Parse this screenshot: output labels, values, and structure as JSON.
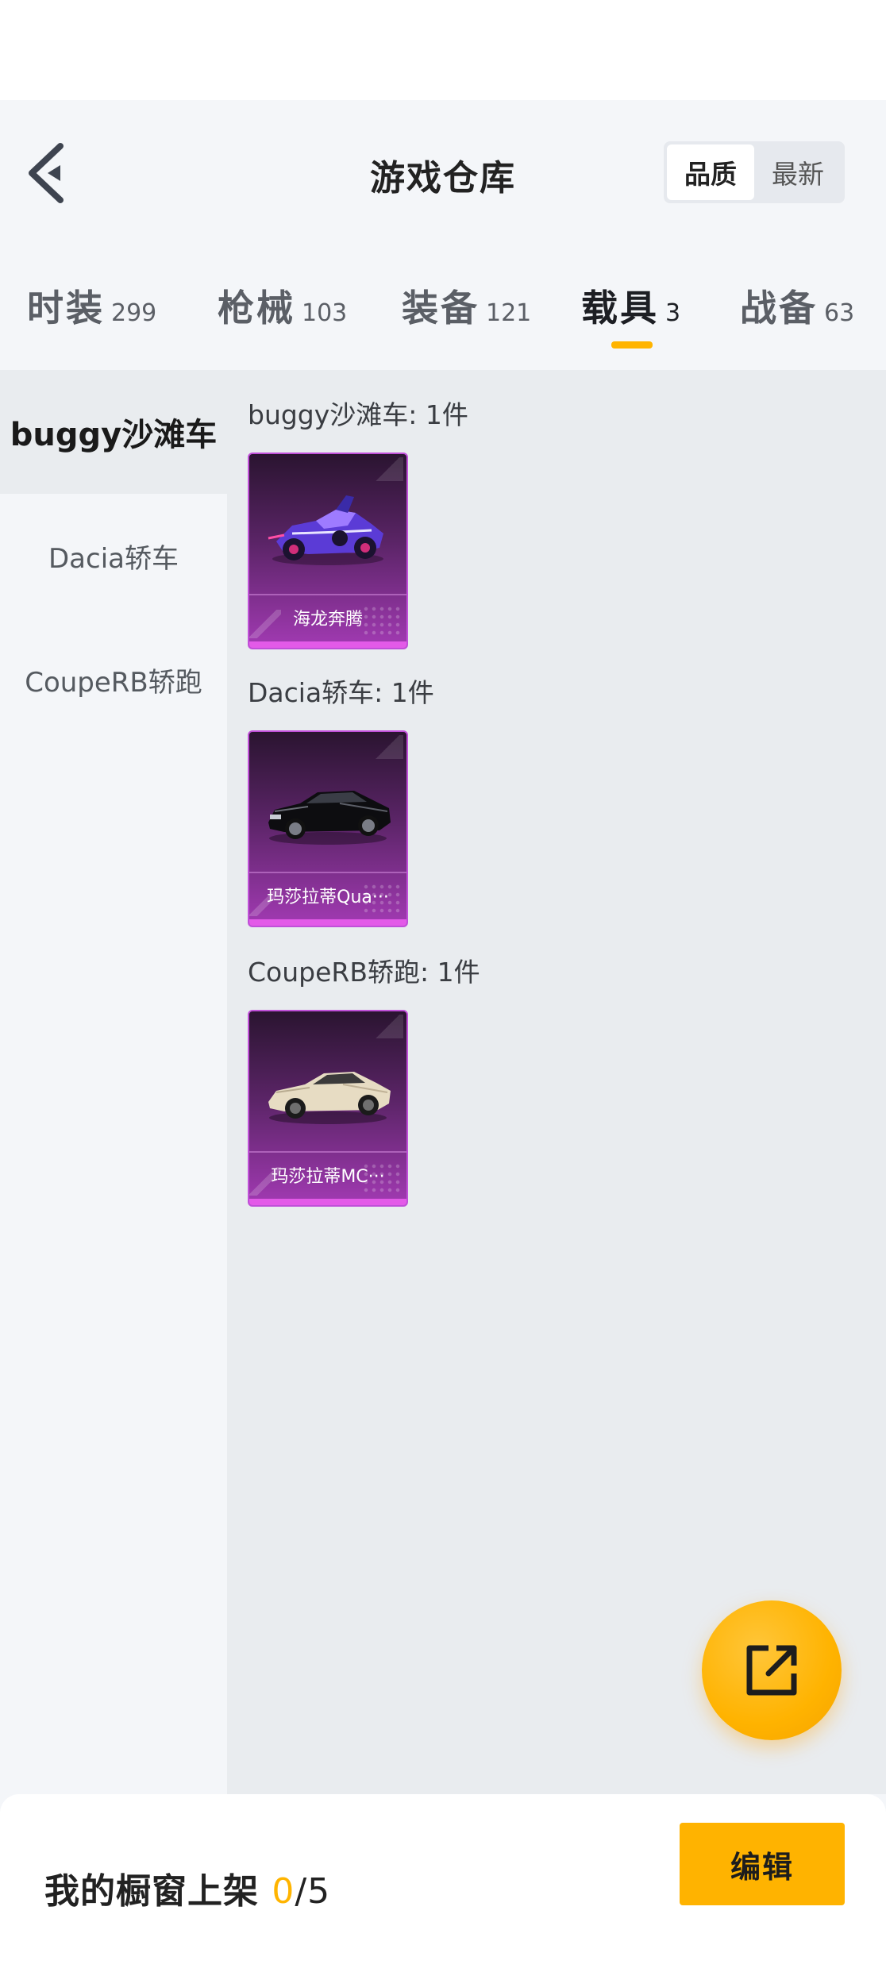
{
  "header": {
    "title": "游戏仓库",
    "sort_options": [
      "品质",
      "最新"
    ],
    "sort_selected": "品质"
  },
  "tabs": [
    {
      "label": "时装",
      "count": "299",
      "active": false
    },
    {
      "label": "枪械",
      "count": "103",
      "active": false
    },
    {
      "label": "装备",
      "count": "121",
      "active": false
    },
    {
      "label": "载具",
      "count": "3",
      "active": true
    },
    {
      "label": "战备",
      "count": "63",
      "active": false
    }
  ],
  "sidebar": {
    "items": [
      {
        "label": "buggy沙滩车",
        "active": true
      },
      {
        "label": "Dacia轿车",
        "active": false
      },
      {
        "label": "CoupeRB轿跑",
        "active": false
      }
    ]
  },
  "groups": [
    {
      "title": "buggy沙滩车: 1件",
      "items": [
        {
          "name": "海龙奔腾",
          "art": "purple-buggy-icon"
        }
      ]
    },
    {
      "title": "Dacia轿车: 1件",
      "items": [
        {
          "name": "玛莎拉蒂Qua···",
          "art": "black-sedan-icon"
        }
      ]
    },
    {
      "title": "CoupeRB轿跑: 1件",
      "items": [
        {
          "name": "玛莎拉蒂MC···",
          "art": "cream-coupe-icon"
        }
      ]
    }
  ],
  "bottom_bar": {
    "label": "我的橱窗上架 ",
    "count_current": "0",
    "count_sep": "/",
    "count_total": "5",
    "edit_label": "编辑"
  },
  "colors": {
    "accent": "#ffb400",
    "card_purple": "#a23ab3",
    "card_bar": "#e35ae8"
  }
}
